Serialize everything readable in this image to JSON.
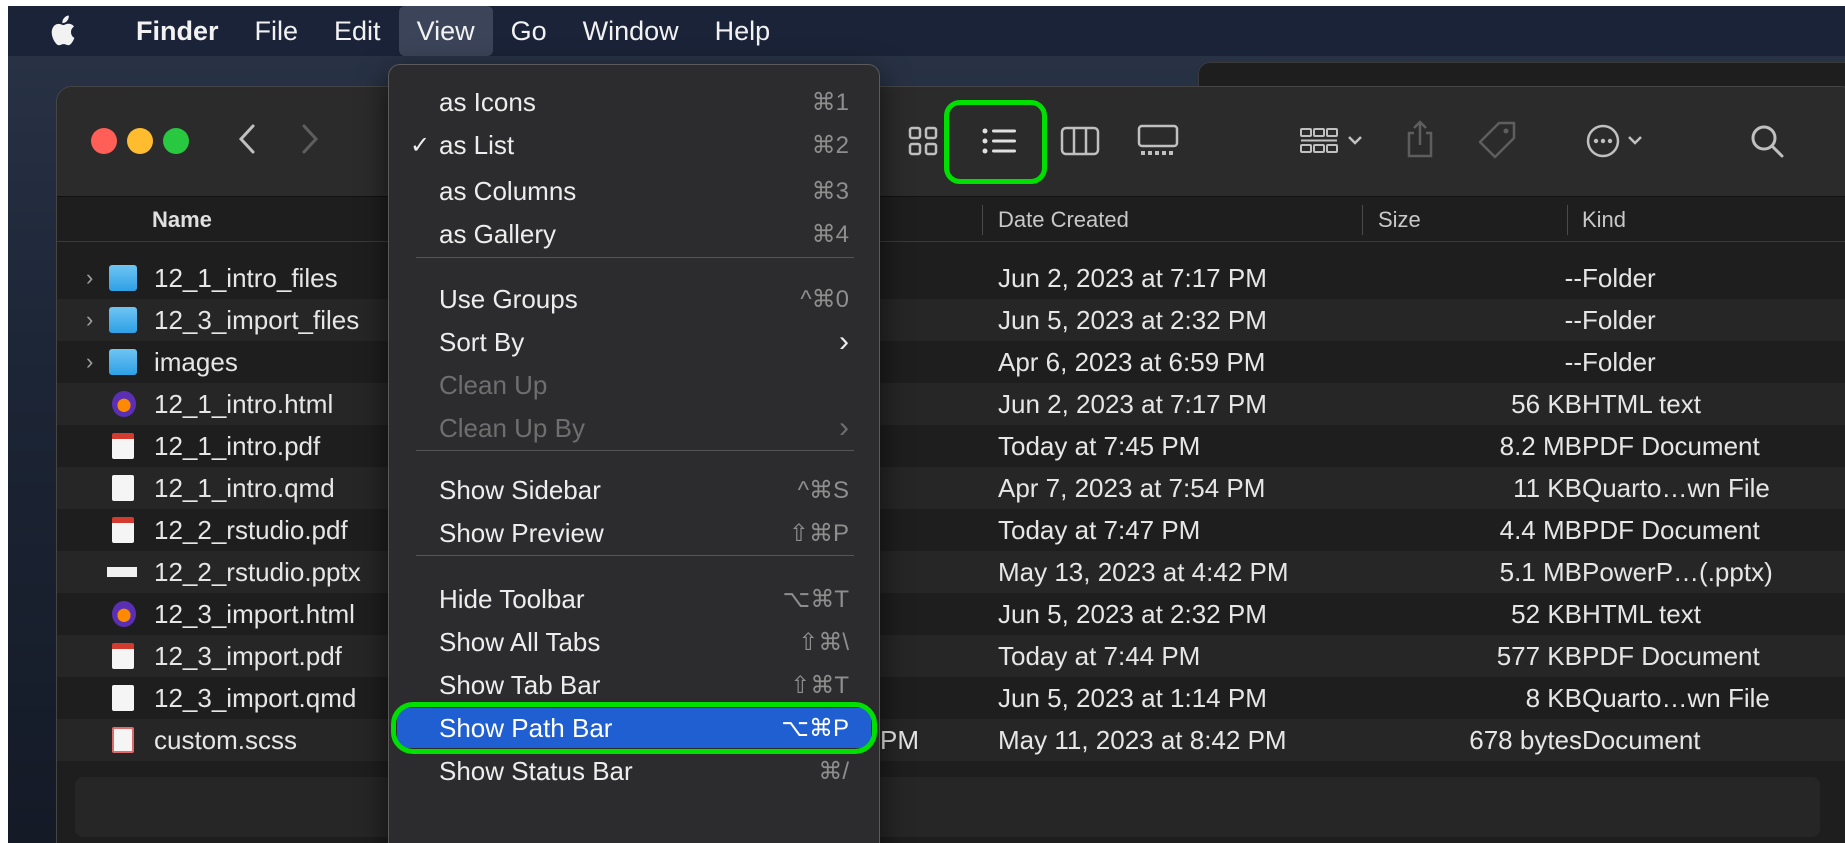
{
  "menubar": {
    "app": "Finder",
    "items": [
      "File",
      "Edit",
      "View",
      "Go",
      "Window",
      "Help"
    ]
  },
  "toolbar": {
    "nav_back": "<",
    "nav_forward": ">"
  },
  "headers": {
    "name": "Name",
    "date_created": "Date Created",
    "size": "Size",
    "kind": "Kind"
  },
  "files": [
    {
      "name": "12_1_intro_files",
      "created": "Jun 2, 2023 at 7:17 PM",
      "size": "--",
      "kind": "Folder",
      "type": "folder",
      "expandable": true
    },
    {
      "name": "12_3_import_files",
      "created": "Jun 5, 2023 at 2:32 PM",
      "size": "--",
      "kind": "Folder",
      "type": "folder",
      "expandable": true
    },
    {
      "name": "images",
      "created": "Apr 6, 2023 at 6:59 PM",
      "size": "--",
      "kind": "Folder",
      "type": "folder",
      "expandable": true
    },
    {
      "name": "12_1_intro.html",
      "created": "Jun 2, 2023 at 7:17 PM",
      "size": "56 KB",
      "kind": "HTML text",
      "type": "html"
    },
    {
      "name": "12_1_intro.pdf",
      "created": "Today at 7:45 PM",
      "size": "8.2 MB",
      "kind": "PDF Document",
      "type": "pdf"
    },
    {
      "name": "12_1_intro.qmd",
      "created": "Apr 7, 2023 at 7:54 PM",
      "size": "11 KB",
      "kind": "Quarto…wn File",
      "type": "doc"
    },
    {
      "name": "12_2_rstudio.pdf",
      "created": "Today at 7:47 PM",
      "size": "4.4 MB",
      "kind": "PDF Document",
      "type": "pdf"
    },
    {
      "name": "12_2_rstudio.pptx",
      "created": "May 13, 2023 at 4:42 PM",
      "size": "5.1 MB",
      "kind": "PowerP…(.pptx)",
      "type": "pptx"
    },
    {
      "name": "12_3_import.html",
      "created": "Jun 5, 2023 at 2:32 PM",
      "size": "52 KB",
      "kind": "HTML text",
      "type": "html"
    },
    {
      "name": "12_3_import.pdf",
      "created": "Today at 7:44 PM",
      "size": "577 KB",
      "kind": "PDF Document",
      "type": "pdf"
    },
    {
      "name": "12_3_import.qmd",
      "created": "Jun 5, 2023 at 1:14 PM",
      "size": "8 KB",
      "kind": "Quarto…wn File",
      "type": "doc"
    },
    {
      "name": "custom.scss",
      "created": "May 11, 2023 at 8:42 PM",
      "size": "678 bytes",
      "kind": "Document",
      "type": "scss"
    }
  ],
  "hidden_column_fragment": "PM",
  "view_menu": {
    "items": [
      {
        "label": "as Icons",
        "shortcut": "⌘1"
      },
      {
        "label": "as List",
        "shortcut": "⌘2",
        "checked": true
      },
      {
        "label": "as Columns",
        "shortcut": "⌘3"
      },
      {
        "label": "as Gallery",
        "shortcut": "⌘4"
      },
      {
        "label": "Use Groups",
        "shortcut": "^⌘0"
      },
      {
        "label": "Sort By",
        "shortcut": ">"
      },
      {
        "label": "Clean Up",
        "shortcut": "",
        "disabled": true
      },
      {
        "label": "Clean Up By",
        "shortcut": ">",
        "disabled": true
      },
      {
        "label": "Show Sidebar",
        "shortcut": "^⌘S"
      },
      {
        "label": "Show Preview",
        "shortcut": "⇧⌘P"
      },
      {
        "label": "Hide Toolbar",
        "shortcut": "⌥⌘T"
      },
      {
        "label": "Show All Tabs",
        "shortcut": "⇧⌘\\"
      },
      {
        "label": "Show Tab Bar",
        "shortcut": "⇧⌘T"
      },
      {
        "label": "Show Path Bar",
        "shortcut": "⌥⌘P",
        "highlighted": true
      },
      {
        "label": "Show Status Bar",
        "shortcut": "⌘/"
      }
    ]
  },
  "colors": {
    "highlight": "#1f5fd1",
    "annotation": "#00e000",
    "close": "#ff5f57",
    "minimize": "#febc2e",
    "zoom": "#28c840"
  }
}
